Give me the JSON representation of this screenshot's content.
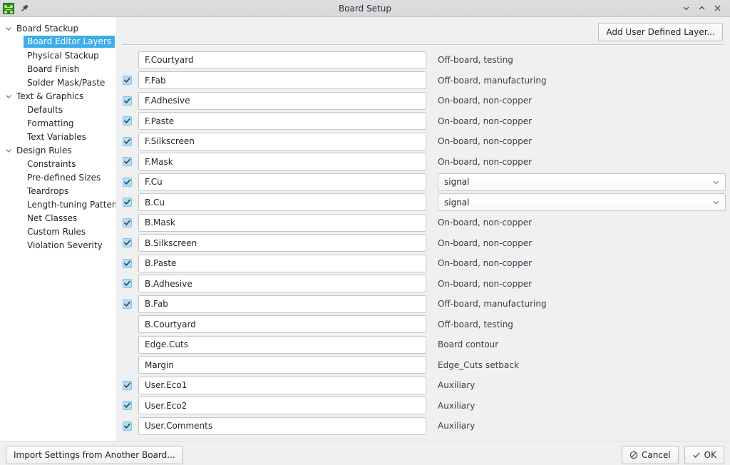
{
  "window": {
    "title": "Board Setup",
    "app_icon": "pcb-board-icon",
    "pin_icon": "pin-icon",
    "minimize_icon": "chevron-down-icon",
    "maximize_icon": "chevron-up-icon",
    "close_icon": "close-icon"
  },
  "sidebar": {
    "items": [
      {
        "label": "Board Stackup",
        "type": "group",
        "expanded": true,
        "selected": false
      },
      {
        "label": "Board Editor Layers",
        "type": "child",
        "selected": true
      },
      {
        "label": "Physical Stackup",
        "type": "child",
        "selected": false
      },
      {
        "label": "Board Finish",
        "type": "child",
        "selected": false
      },
      {
        "label": "Solder Mask/Paste",
        "type": "child",
        "selected": false
      },
      {
        "label": "Text & Graphics",
        "type": "group",
        "expanded": true,
        "selected": false
      },
      {
        "label": "Defaults",
        "type": "child",
        "selected": false
      },
      {
        "label": "Formatting",
        "type": "child",
        "selected": false
      },
      {
        "label": "Text Variables",
        "type": "child",
        "selected": false
      },
      {
        "label": "Design Rules",
        "type": "group",
        "expanded": true,
        "selected": false
      },
      {
        "label": "Constraints",
        "type": "child",
        "selected": false
      },
      {
        "label": "Pre-defined Sizes",
        "type": "child",
        "selected": false
      },
      {
        "label": "Teardrops",
        "type": "child",
        "selected": false
      },
      {
        "label": "Length-tuning Patterns",
        "type": "child",
        "selected": false
      },
      {
        "label": "Net Classes",
        "type": "child",
        "selected": false
      },
      {
        "label": "Custom Rules",
        "type": "child",
        "selected": false
      },
      {
        "label": "Violation Severity",
        "type": "child",
        "selected": false
      }
    ]
  },
  "main": {
    "add_layer_button": "Add User Defined Layer...",
    "layers": [
      {
        "checked": false,
        "name": "F.Courtyard",
        "kind": "text",
        "desc": "Off-board, testing"
      },
      {
        "checked": true,
        "name": "F.Fab",
        "kind": "text",
        "desc": "Off-board, manufacturing"
      },
      {
        "checked": true,
        "name": "F.Adhesive",
        "kind": "text",
        "desc": "On-board, non-copper"
      },
      {
        "checked": true,
        "name": "F.Paste",
        "kind": "text",
        "desc": "On-board, non-copper"
      },
      {
        "checked": true,
        "name": "F.Silkscreen",
        "kind": "text",
        "desc": "On-board, non-copper"
      },
      {
        "checked": true,
        "name": "F.Mask",
        "kind": "text",
        "desc": "On-board, non-copper"
      },
      {
        "checked": true,
        "name": "F.Cu",
        "kind": "select",
        "desc": "signal"
      },
      {
        "checked": true,
        "name": "B.Cu",
        "kind": "select",
        "desc": "signal"
      },
      {
        "checked": true,
        "name": "B.Mask",
        "kind": "text",
        "desc": "On-board, non-copper"
      },
      {
        "checked": true,
        "name": "B.Silkscreen",
        "kind": "text",
        "desc": "On-board, non-copper"
      },
      {
        "checked": true,
        "name": "B.Paste",
        "kind": "text",
        "desc": "On-board, non-copper"
      },
      {
        "checked": true,
        "name": "B.Adhesive",
        "kind": "text",
        "desc": "On-board, non-copper"
      },
      {
        "checked": true,
        "name": "B.Fab",
        "kind": "text",
        "desc": "Off-board, manufacturing"
      },
      {
        "checked": false,
        "name": "B.Courtyard",
        "kind": "text",
        "desc": "Off-board, testing"
      },
      {
        "checked": false,
        "name": "Edge.Cuts",
        "kind": "text",
        "desc": "Board contour"
      },
      {
        "checked": false,
        "name": "Margin",
        "kind": "text",
        "desc": "Edge_Cuts setback"
      },
      {
        "checked": true,
        "name": "User.Eco1",
        "kind": "text",
        "desc": "Auxiliary"
      },
      {
        "checked": true,
        "name": "User.Eco2",
        "kind": "text",
        "desc": "Auxiliary"
      },
      {
        "checked": true,
        "name": "User.Comments",
        "kind": "text",
        "desc": "Auxiliary"
      }
    ]
  },
  "footer": {
    "import_button": "Import Settings from Another Board...",
    "cancel_button": "Cancel",
    "ok_button": "OK",
    "cancel_icon": "no-entry-icon",
    "ok_icon": "check-icon"
  },
  "colors": {
    "accent": "#3daee9",
    "window_bg": "#eff0f1",
    "panel_bg": "#ffffff",
    "checkbox_fill": "#b8dcf2",
    "check_mark": "#1f4f6e"
  }
}
